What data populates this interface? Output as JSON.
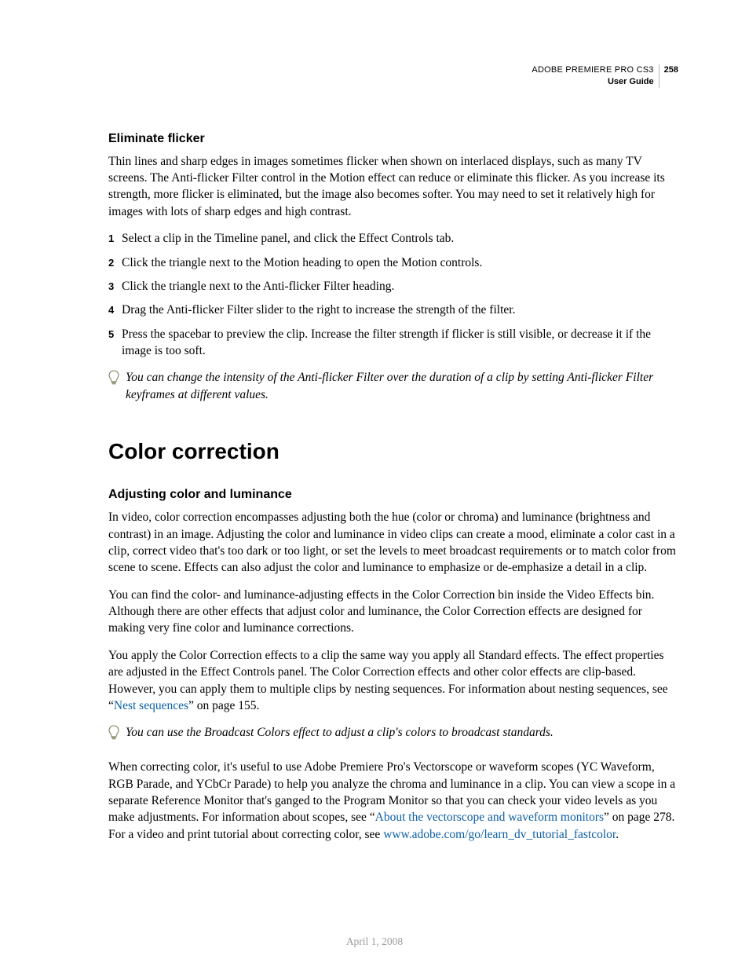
{
  "header": {
    "product": "ADOBE PREMIERE PRO CS3",
    "guide": "User Guide",
    "page": "258"
  },
  "section1": {
    "heading": "Eliminate flicker",
    "intro": "Thin lines and sharp edges in images sometimes flicker when shown on interlaced displays, such as many TV screens. The Anti-flicker Filter control in the Motion effect can reduce or eliminate this flicker. As you increase its strength, more flicker is eliminated, but the image also becomes softer. You may need to set it relatively high for images with lots of sharp edges and high contrast.",
    "steps": [
      "Select a clip in the Timeline panel, and click the Effect Controls tab.",
      "Click the triangle next to the Motion heading to open the Motion controls.",
      "Click the triangle next to the Anti-flicker Filter heading.",
      "Drag the Anti-flicker Filter slider to the right to increase the strength of the filter.",
      "Press the spacebar to preview the clip. Increase the filter strength if flicker is still visible, or decrease it if the image is too soft."
    ],
    "tip": "You can change the intensity of the Anti-flicker Filter over the duration of a clip by setting Anti-flicker Filter keyframes at different values."
  },
  "section2": {
    "heading": "Color correction",
    "subheading": "Adjusting color and luminance",
    "p1": "In video, color correction encompasses adjusting both the hue (color or chroma) and luminance (brightness and contrast) in an image. Adjusting the color and luminance in video clips can create a mood, eliminate a color cast in a clip, correct video that's too dark or too light, or set the levels to meet broadcast requirements or to match color from scene to scene. Effects can also adjust the color and luminance to emphasize or de-emphasize a detail in a clip.",
    "p2": "You can find the color- and luminance-adjusting effects in the Color Correction bin inside the Video Effects bin. Although there are other effects that adjust color and luminance, the Color Correction effects are designed for making very fine color and luminance corrections.",
    "p3_a": "You apply the Color Correction effects to a clip the same way you apply all Standard effects. The effect properties are adjusted in the Effect Controls panel. The Color Correction effects and other color effects are clip-based. However, you can apply them to multiple clips by nesting sequences. For information about nesting sequences, see “",
    "p3_link": "Nest sequences",
    "p3_b": "” on page 155.",
    "tip": "You can use the Broadcast Colors effect to adjust a clip's colors to broadcast standards.",
    "p4_a": "When correcting color, it's useful to use Adobe Premiere Pro's Vectorscope or waveform scopes (YC Waveform, RGB Parade, and YCbCr Parade) to help you analyze the chroma and luminance in a clip. You can view a scope in a separate Reference Monitor that's ganged to the Program Monitor so that you can check your video levels as you make adjustments. For information about scopes, see “",
    "p4_link1": "About the vectorscope and waveform monitors",
    "p4_b": "” on page 278. For a video and print tutorial about correcting color, see ",
    "p4_link2": "www.adobe.com/go/learn_dv_tutorial_fastcolor",
    "p4_c": "."
  },
  "footer": {
    "date": "April 1, 2008"
  }
}
